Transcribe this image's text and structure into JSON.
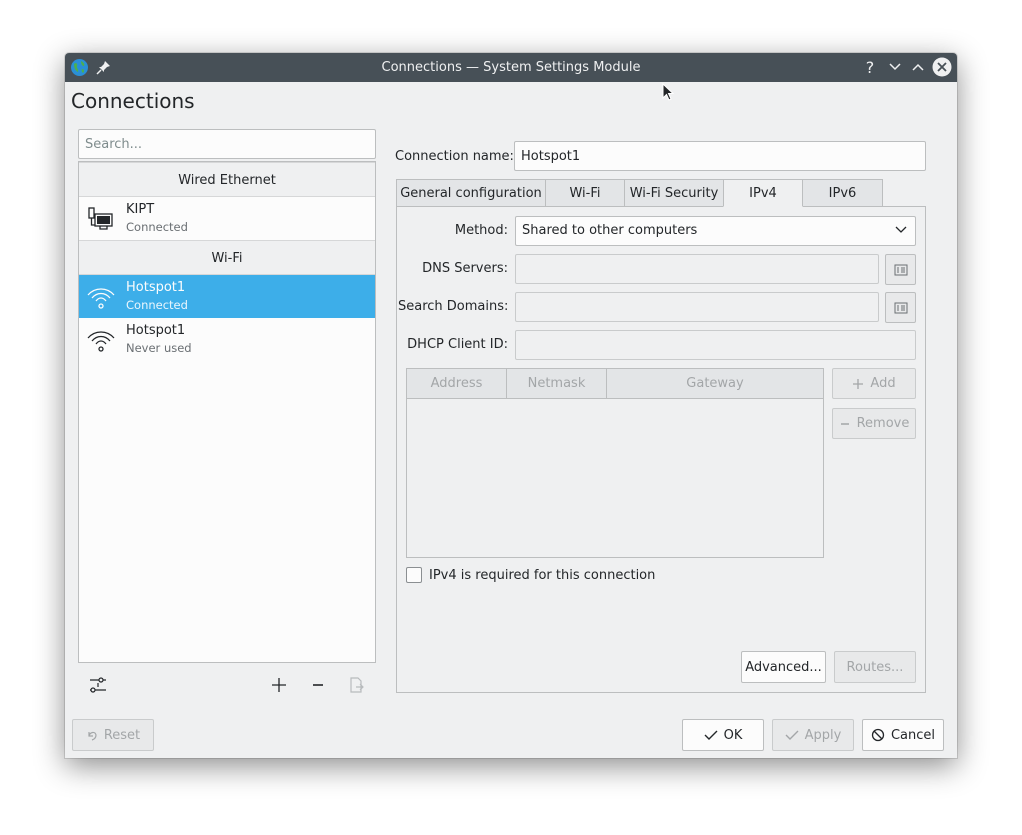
{
  "window": {
    "title": "Connections — System Settings Module",
    "page_title": "Connections"
  },
  "titlebar": {
    "app_icon": "globe-icon",
    "pin_icon": "pin-icon",
    "help_label": "?",
    "minimize_icon": "chevron-down-icon",
    "maximize_icon": "chevron-up-icon",
    "close_icon": "close-icon"
  },
  "sidebar": {
    "search_placeholder": "Search...",
    "groups": [
      {
        "header": "Wired Ethernet"
      },
      {
        "header": "Wi-Fi"
      }
    ],
    "items": [
      {
        "name": "KIPT",
        "status": "Connected",
        "icon": "wired-network-icon",
        "selected": false
      },
      {
        "name": "Hotspot1",
        "status": "Connected",
        "icon": "wifi-icon",
        "selected": true
      },
      {
        "name": "Hotspot1",
        "status": "Never used",
        "icon": "wifi-icon",
        "selected": false
      }
    ],
    "bottom_icons": [
      "configure-icon",
      "add-icon",
      "remove-icon",
      "export-icon"
    ]
  },
  "editor": {
    "connection_name_label": "Connection name:",
    "connection_name_value": "Hotspot1",
    "tabs": [
      "General configuration",
      "Wi-Fi",
      "Wi-Fi Security",
      "IPv4",
      "IPv6"
    ],
    "active_tab": "IPv4",
    "method_label": "Method:",
    "method_value": "Shared to other computers",
    "dns_label": "DNS Servers:",
    "dns_value": "",
    "search_domains_label": "Search Domains:",
    "search_domains_value": "",
    "dhcp_label": "DHCP Client ID:",
    "dhcp_value": "",
    "table_columns": [
      "Address",
      "Netmask",
      "Gateway"
    ],
    "add_label": "Add",
    "remove_label": "Remove",
    "ipv4_required_label": "IPv4 is required for this connection",
    "ipv4_required_checked": false,
    "advanced_label": "Advanced...",
    "routes_label": "Routes..."
  },
  "footer": {
    "reset_label": "Reset",
    "ok_label": "OK",
    "apply_label": "Apply",
    "cancel_label": "Cancel"
  },
  "colors": {
    "selection": "#3daee9",
    "titlebar": "#475057",
    "window_bg": "#eff0f1"
  }
}
